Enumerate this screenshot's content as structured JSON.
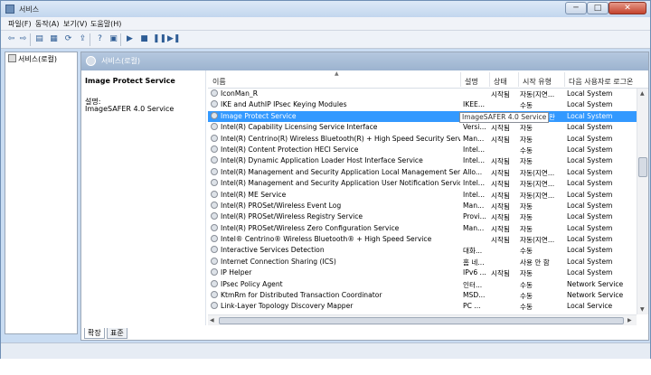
{
  "window": {
    "title": "서비스",
    "min": "─",
    "max": "□",
    "close": "✕"
  },
  "menu": [
    "파일(F)",
    "동작(A)",
    "보기(V)",
    "도움말(H)"
  ],
  "toolbar": {
    "icons": [
      "back-icon",
      "forward-icon",
      "console-tree-icon",
      "properties-icon",
      "refresh-icon",
      "export-icon",
      "help-icon",
      "mmc-icon",
      "play-icon",
      "stop-icon",
      "pause-icon",
      "restart-icon"
    ],
    "glyphs": [
      "⇦",
      "⇨",
      "▤",
      "▦",
      "⟳",
      "⇪",
      "?",
      "▣",
      "▶",
      "■",
      "❚❚",
      "▶❚"
    ]
  },
  "tree": {
    "item": "서비스(로컬)"
  },
  "pane": {
    "title": "서비스(로컬)"
  },
  "details": {
    "title": "Image Protect Service",
    "label": "설명:",
    "text": "ImageSAFER 4.0 Service"
  },
  "columns": {
    "name": "이름",
    "desc": "설명",
    "status": "상태",
    "type": "시작 유형",
    "logon": "다음 사용자로 로그온"
  },
  "rows": [
    {
      "name": "IconMan_R",
      "desc": "",
      "status": "시작됨",
      "type": "자동(지연...",
      "logon": "Local System"
    },
    {
      "name": "IKE and AuthIP IPsec Keying Modules",
      "desc": "IKEE...",
      "status": "",
      "type": "수동",
      "logon": "Local System"
    },
    {
      "name": "Image Protect Service",
      "desc": "",
      "status": "",
      "type": "",
      "logon": "Local System",
      "selected": true,
      "tooltip": "ImageSAFER 4.0 Service",
      "tail": "완"
    },
    {
      "name": "Intel(R) Capability Licensing Service Interface",
      "desc": "Versi...",
      "status": "시작됨",
      "type": "자동",
      "logon": "Local System"
    },
    {
      "name": "Intel(R) Centrino(R) Wireless Bluetooth(R) + High Speed Security Service",
      "desc": "Man...",
      "status": "시작됨",
      "type": "자동",
      "logon": "Local System"
    },
    {
      "name": "Intel(R) Content Protection HECI Service",
      "desc": "Intel...",
      "status": "",
      "type": "수동",
      "logon": "Local System"
    },
    {
      "name": "Intel(R) Dynamic Application Loader Host Interface Service",
      "desc": "Intel...",
      "status": "시작됨",
      "type": "자동",
      "logon": "Local System"
    },
    {
      "name": "Intel(R) Management and Security Application Local Management Service",
      "desc": "Allo...",
      "status": "시작됨",
      "type": "자동(지연...",
      "logon": "Local System"
    },
    {
      "name": "Intel(R) Management and Security Application User Notification Service",
      "desc": "Intel...",
      "status": "시작됨",
      "type": "자동(지연...",
      "logon": "Local System"
    },
    {
      "name": "Intel(R) ME Service",
      "desc": "Intel...",
      "status": "시작됨",
      "type": "자동(지연...",
      "logon": "Local System"
    },
    {
      "name": "Intel(R) PROSet/Wireless Event Log",
      "desc": "Man...",
      "status": "시작됨",
      "type": "자동",
      "logon": "Local System"
    },
    {
      "name": "Intel(R) PROSet/Wireless Registry Service",
      "desc": "Provi...",
      "status": "시작됨",
      "type": "자동",
      "logon": "Local System"
    },
    {
      "name": "Intel(R) PROSet/Wireless Zero Configuration Service",
      "desc": "Man...",
      "status": "시작됨",
      "type": "자동",
      "logon": "Local System"
    },
    {
      "name": "Intel® Centrino® Wireless Bluetooth® + High Speed Service",
      "desc": "",
      "status": "시작됨",
      "type": "자동(지연...",
      "logon": "Local System"
    },
    {
      "name": "Interactive Services Detection",
      "desc": "대화...",
      "status": "",
      "type": "수동",
      "logon": "Local System"
    },
    {
      "name": "Internet Connection Sharing (ICS)",
      "desc": "홈 네...",
      "status": "",
      "type": "사용 안 함",
      "logon": "Local System"
    },
    {
      "name": "IP Helper",
      "desc": "IPv6 ...",
      "status": "시작됨",
      "type": "자동",
      "logon": "Local System"
    },
    {
      "name": "IPsec Policy Agent",
      "desc": "인터...",
      "status": "",
      "type": "수동",
      "logon": "Network Service"
    },
    {
      "name": "KtmRm for Distributed Transaction Coordinator",
      "desc": "MSD...",
      "status": "",
      "type": "수동",
      "logon": "Network Service"
    },
    {
      "name": "Link-Layer Topology Discovery Mapper",
      "desc": "PC ...",
      "status": "",
      "type": "수동",
      "logon": "Local Service"
    }
  ],
  "tabs": [
    "확장",
    "표준"
  ]
}
